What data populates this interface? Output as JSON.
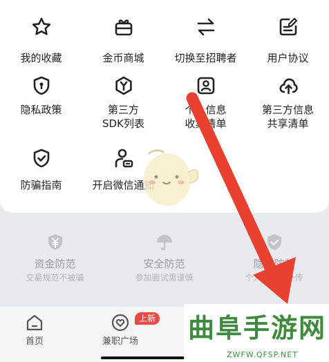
{
  "menu": {
    "items": [
      {
        "label": "我的收藏",
        "icon": "star-icon"
      },
      {
        "label": "金币商城",
        "icon": "gift-icon"
      },
      {
        "label": "切换至招聘者",
        "icon": "switch-arrows-icon"
      },
      {
        "label": "用户协议",
        "icon": "edit-document-icon"
      },
      {
        "label": "隐私政策",
        "icon": "shield-keyhole-icon"
      },
      {
        "label": "第三方\nSDK列表",
        "icon": "shield-y-icon"
      },
      {
        "label": "个人信息\n收集清单",
        "icon": "profile-card-icon"
      },
      {
        "label": "第三方信息\n共享清单",
        "icon": "cloud-upload-icon"
      },
      {
        "label": "防骗指南",
        "icon": "shield-check-icon"
      },
      {
        "label": "开启微信通知",
        "icon": "user-notify-icon"
      }
    ]
  },
  "safety": {
    "items": [
      {
        "title": "资金防范",
        "subtitle": "交易规范不被骗",
        "icon": "yuan-shield-icon"
      },
      {
        "title": "安全防范",
        "subtitle": "参加面试需谨慎",
        "icon": "umbrella-icon"
      },
      {
        "title": "隐私防范",
        "subtitle": "个人信息不外传",
        "icon": "shield-check-icon"
      }
    ]
  },
  "tabbar": {
    "tabs": [
      {
        "label": "首页",
        "icon": "home-icon"
      },
      {
        "label": "兼职广场",
        "icon": "heart-circle-icon"
      }
    ],
    "badge": "上新"
  },
  "watermark": {
    "brand": "曲阜手游网",
    "url": "ZWFW.QFSP.NET"
  },
  "colors": {
    "accent_red": "#ea4a44",
    "arrow_red": "#e8412f",
    "watermark_green": "#3f8a3f"
  }
}
